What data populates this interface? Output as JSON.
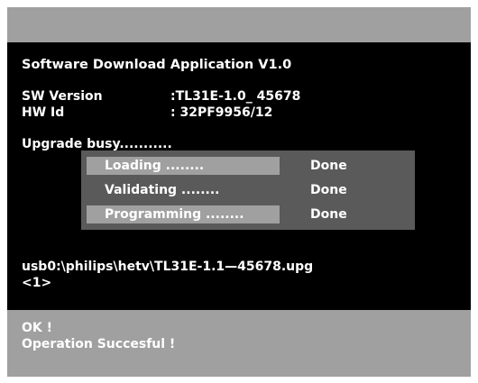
{
  "app": {
    "title": "Software Download Application   V1.0"
  },
  "info": {
    "sw_label": "SW Version",
    "sw_value": ":TL31E-1.0_ 45678",
    "hw_label": "HW Id",
    "hw_value": ": 32PF9956/12"
  },
  "status": {
    "text": "Upgrade busy..........."
  },
  "steps": [
    {
      "label": "Loading ........",
      "status": "Done",
      "highlighted": true
    },
    {
      "label": "Validating ........",
      "status": "Done",
      "highlighted": false
    },
    {
      "label": "Programming ........",
      "status": "Done",
      "highlighted": true
    }
  ],
  "file": {
    "path": "usb0:\\philips\\hetv\\TL31E-1.1—45678.upg",
    "index": "<1>"
  },
  "result": {
    "ok": "OK !",
    "message": "Operation Succesful !"
  },
  "colors": {
    "band": "#a0a0a0",
    "background": "#000000",
    "box": "#5a5a5a",
    "text": "#ffffff"
  }
}
